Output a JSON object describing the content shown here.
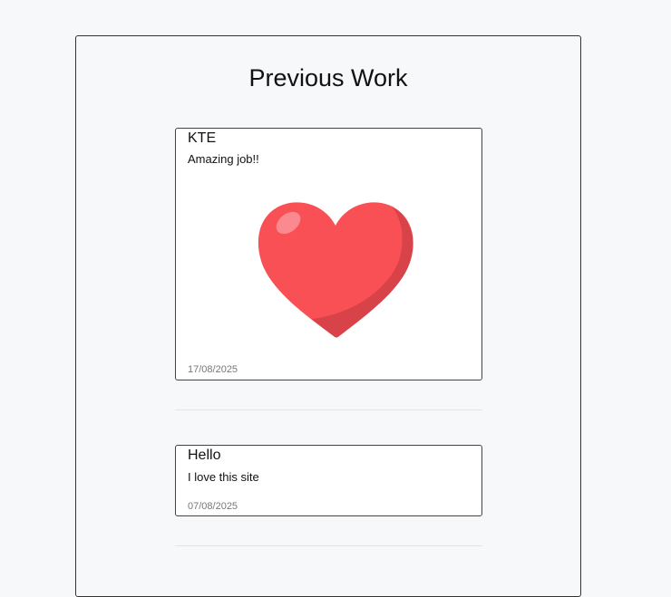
{
  "page": {
    "title": "Previous Work"
  },
  "cards": [
    {
      "title": "KTE",
      "text": "Amazing job!!",
      "date": "17/08/2025",
      "image": "heart-emoji"
    },
    {
      "title": "Hello",
      "text": "I love this site",
      "date": "07/08/2025"
    }
  ],
  "colors": {
    "heart": "#f85055",
    "heart_shadow": "#d8434a",
    "heart_highlight": "#fb8a90"
  }
}
